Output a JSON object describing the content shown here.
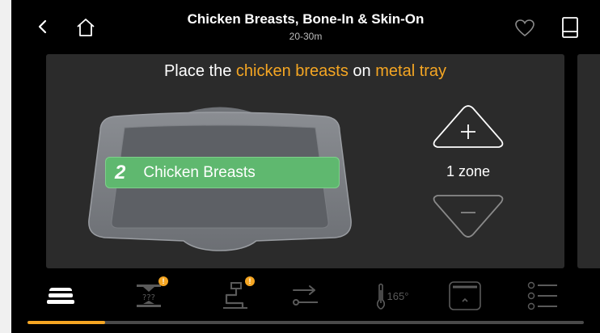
{
  "header": {
    "title": "Chicken Breasts, Bone-In & Skin-On",
    "subtitle": "20-30m",
    "icons": [
      "back-chevron-icon",
      "home-icon",
      "heart-icon",
      "recipe-book-icon"
    ]
  },
  "main": {
    "instruction": {
      "prefix": "Place the ",
      "highlight_1": "chicken breasts",
      "middle": " on ",
      "highlight_2": "metal tray"
    },
    "food_item": {
      "count": "2",
      "label": "Chicken Breasts"
    },
    "zones": {
      "label": "1 zone",
      "increase_icon": "plus-icon",
      "decrease_icon": "minus-icon"
    }
  },
  "steps": {
    "icons": [
      "tray-stack-icon",
      "weight-icon",
      "thickness-icon",
      "transfer-icon",
      "thermometer-icon",
      "oven-door-icon",
      "checklist-icon"
    ],
    "temperature": "165°",
    "badge_symbol": "!",
    "progress": 0.14
  },
  "colors": {
    "accent": "#f5a623",
    "food_chip": "#5fb86f",
    "card": "#2b2b2b",
    "background": "#000000"
  }
}
